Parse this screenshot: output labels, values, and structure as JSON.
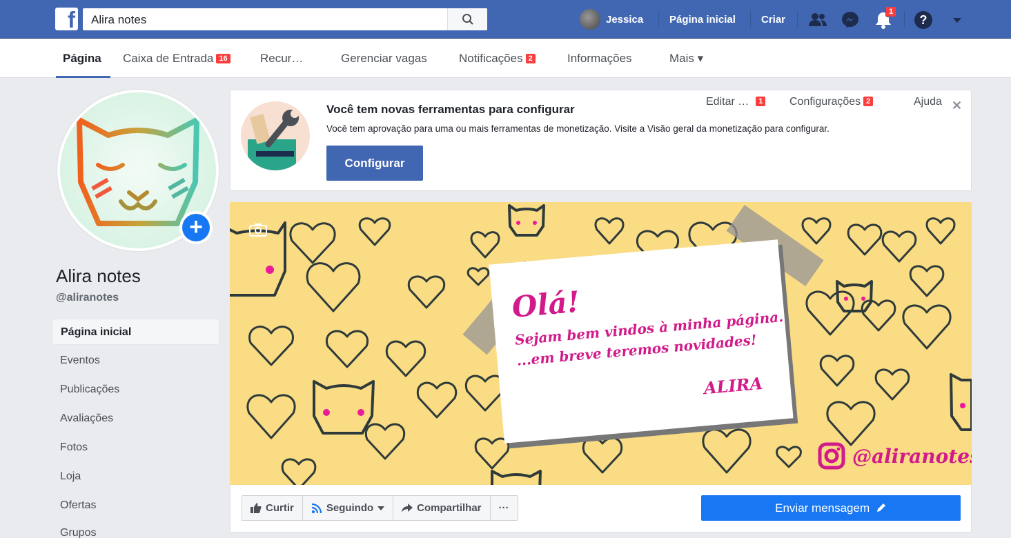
{
  "topbar": {
    "search_value": "Alira notes",
    "user_name": "Jessica",
    "home_label": "Página inicial",
    "create_label": "Criar",
    "notifications_count": "1",
    "brand_color": "#4267b2"
  },
  "page_nav": {
    "tabs": [
      {
        "label": "Página",
        "active": true
      },
      {
        "label": "Caixa de Entrada",
        "badge": "16"
      },
      {
        "label": "Recur…"
      },
      {
        "label": "Gerenciar vagas"
      },
      {
        "label": "Notificações",
        "badge": "2"
      },
      {
        "label": "Informações"
      },
      {
        "label": "Mais ▾"
      }
    ]
  },
  "sidebar": {
    "page_name": "Alira notes",
    "handle": "@aliranotes",
    "items": [
      {
        "label": "Página inicial",
        "active": true
      },
      {
        "label": "Eventos"
      },
      {
        "label": "Publicações"
      },
      {
        "label": "Avaliações"
      },
      {
        "label": "Fotos"
      },
      {
        "label": "Loja"
      },
      {
        "label": "Ofertas"
      },
      {
        "label": "Grupos"
      }
    ]
  },
  "notice": {
    "title": "Você tem novas ferramentas para configurar",
    "body": "Você tem aprovação para uma ou mais ferramentas de monetização. Visite a Visão geral da monetização para configurar.",
    "button_label": "Configurar",
    "edit_label": "Editar …",
    "edit_badge": "1",
    "settings_label": "Configurações",
    "settings_badge": "2",
    "help_label": "Ajuda",
    "close_glyph": "✕"
  },
  "cover": {
    "hello": "Olá!",
    "line1": "Sejam bem vindos à minha página.",
    "line2": "...em breve teremos novidades!",
    "signature": "ALIRA",
    "instagram": "@aliranotes",
    "accent_color": "#d21b8a",
    "background_color": "#fadc85"
  },
  "actions": {
    "like_label": "Curtir",
    "follow_label": "Seguindo",
    "share_label": "Compartilhar",
    "more_label": "···",
    "message_label": "Enviar mensagem"
  }
}
